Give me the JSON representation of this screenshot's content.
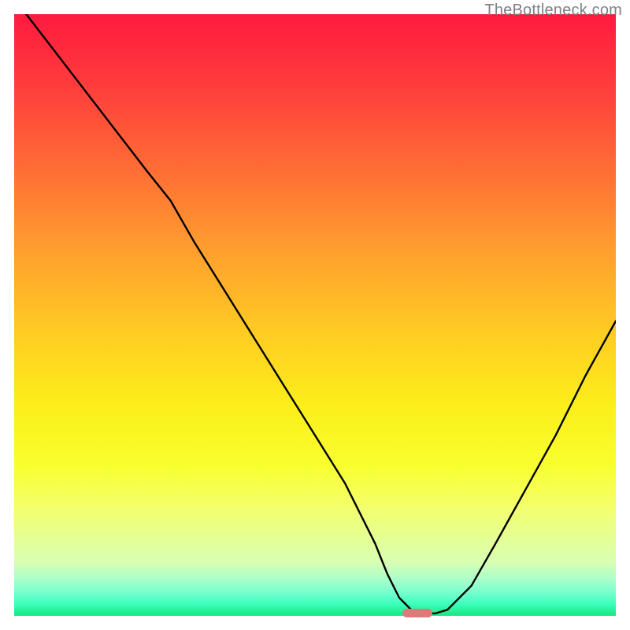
{
  "watermark": "TheBottleneck.com",
  "colors": {
    "gradient_top": "#ff1a3e",
    "gradient_mid1": "#ff9a2f",
    "gradient_mid2": "#fcee1a",
    "gradient_bottom": "#14e87e",
    "curve": "#000000",
    "marker": "#e0787a",
    "axes": "#000000"
  },
  "chart_data": {
    "type": "line",
    "title": "",
    "xlabel": "",
    "ylabel": "",
    "xlim": [
      0,
      100
    ],
    "ylim": [
      0,
      100
    ],
    "grid": false,
    "legend": false,
    "series": [
      {
        "name": "bottleneck-curve",
        "x": [
          2,
          12,
          22,
          26,
          30,
          35,
          40,
          45,
          50,
          55,
          60,
          62,
          64,
          66,
          68,
          70,
          72,
          76,
          80,
          85,
          90,
          95,
          100
        ],
        "y": [
          100,
          87,
          74,
          69,
          62,
          54,
          46,
          38,
          30,
          22,
          12,
          7,
          3,
          1,
          0.4,
          0.4,
          1,
          5,
          12,
          21,
          30,
          40,
          49
        ]
      }
    ],
    "annotations": [
      {
        "name": "optimal-marker",
        "type": "pill",
        "x_center": 67,
        "y": 0.4,
        "width_pct": 5
      }
    ]
  }
}
